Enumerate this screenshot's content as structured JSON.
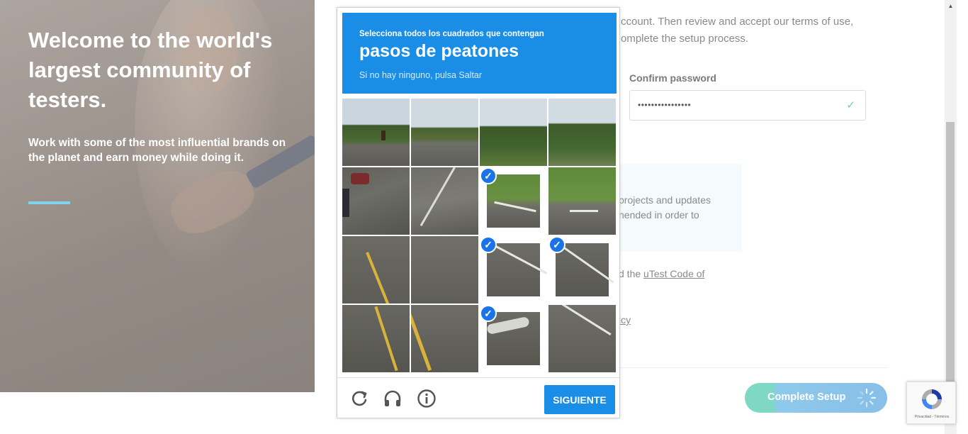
{
  "hero": {
    "title": "Welcome to the world's largest community of testers.",
    "description": "Work with some of the most influential brands on the planet and earn money while doing it."
  },
  "form": {
    "intro_line1": "ccount. Then review and accept our terms of use,",
    "intro_line2": "omplete the setup process.",
    "confirm_password_label": "Confirm password",
    "confirm_password_value": "••••••••••••••••",
    "notice_line1": " projects and updates",
    "notice_line2": "nended in order to",
    "code_prefix": "d the ",
    "code_link": "uTest Code of",
    "policy_fragment": "icy",
    "complete_button": "Complete Setup"
  },
  "captcha": {
    "instruction": "Selecciona todos los cuadrados que contengan",
    "object": "pasos de peatones",
    "hint": "Si no hay ninguno, pulsa Saltar",
    "next_button": "SIGUIENTE",
    "selected_tiles": [
      6,
      10,
      11,
      14
    ],
    "icons": [
      "reload-icon",
      "audio-icon",
      "info-icon"
    ]
  },
  "badge": {
    "terms": "Privacidad - Términos"
  },
  "colors": {
    "captcha_blue": "#1a8ee7",
    "hero_accent": "#7fd3ea",
    "check_green": "#6fcfae"
  }
}
